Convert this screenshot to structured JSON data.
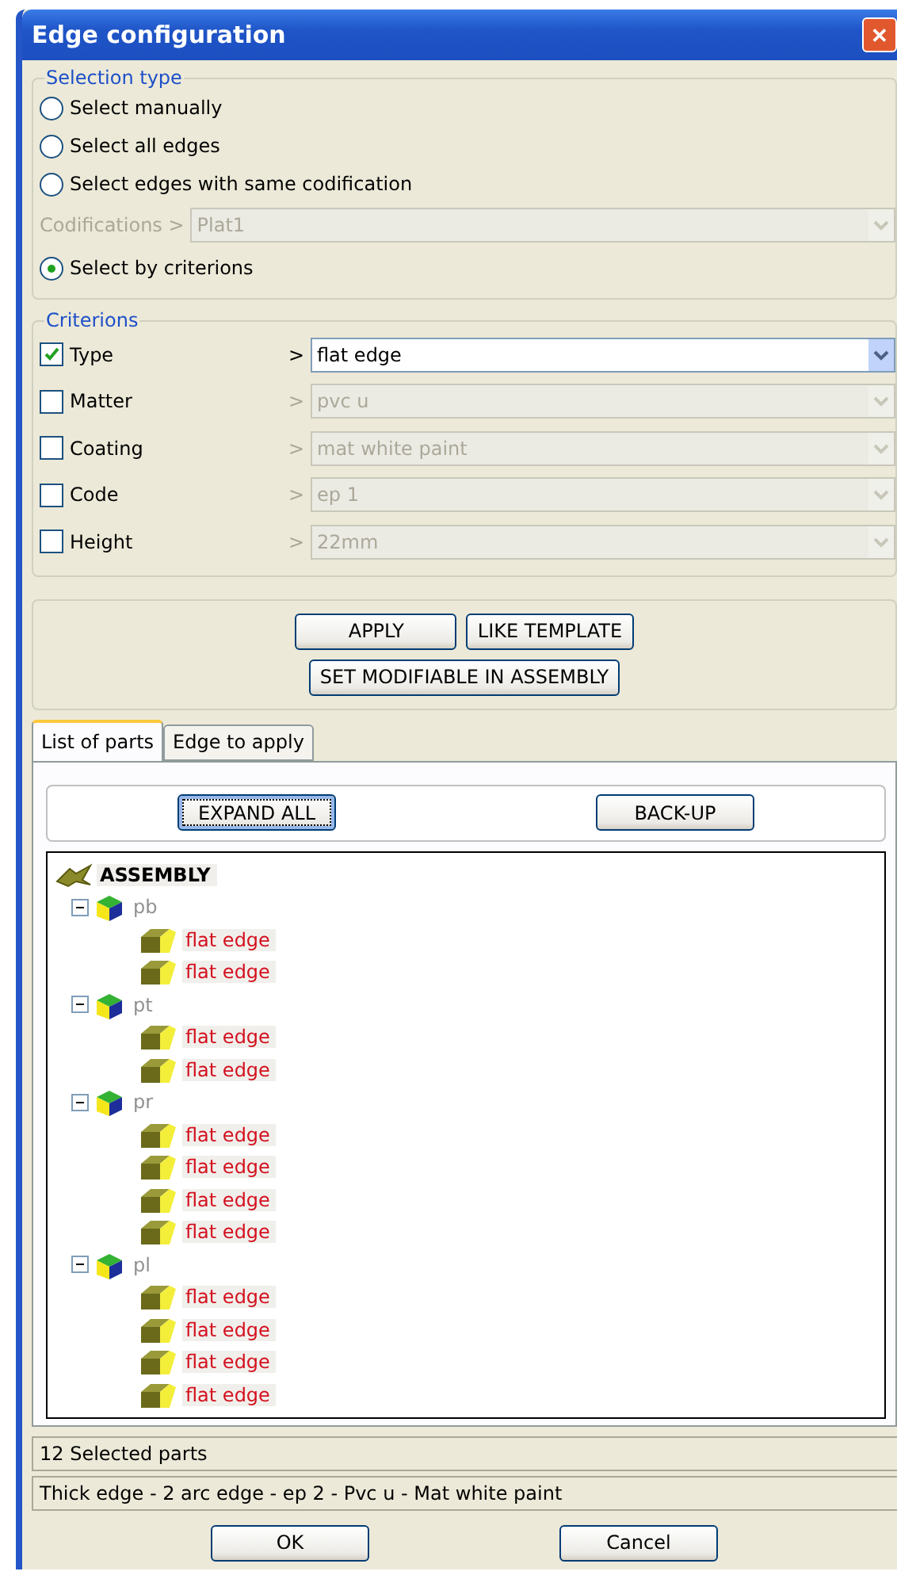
{
  "window": {
    "title": "Edge configuration",
    "close": "✕"
  },
  "selection_type": {
    "legend": "Selection type",
    "options": [
      {
        "label": "Select manually",
        "selected": false
      },
      {
        "label": "Select all edges",
        "selected": false
      },
      {
        "label": "Select edges with same codification",
        "selected": false
      },
      {
        "label": "Select by criterions",
        "selected": true
      }
    ],
    "codifications": {
      "label": "Codifications >",
      "value": "Plat1",
      "disabled": true
    }
  },
  "criterions": {
    "legend": "Criterions",
    "rows": [
      {
        "label": "Type",
        "checked": true,
        "separator": ">",
        "value": "flat edge"
      },
      {
        "label": "Matter",
        "checked": false,
        "separator": ">",
        "value": "pvc u"
      },
      {
        "label": "Coating",
        "checked": false,
        "separator": ">",
        "value": "mat white paint"
      },
      {
        "label": "Code",
        "checked": false,
        "separator": ">",
        "value": "ep 1"
      },
      {
        "label": "Height",
        "checked": false,
        "separator": ">",
        "value": "22mm"
      }
    ]
  },
  "actions": [
    "APPLY",
    "LIKE TEMPLATE",
    "SET MODIFIABLE IN ASSEMBLY"
  ],
  "tabs": [
    {
      "label": "List of parts",
      "selected": true
    },
    {
      "label": "Edge to apply",
      "selected": false
    }
  ],
  "tree_buttons": [
    {
      "label": "EXPAND ALL",
      "focused": true
    },
    {
      "label": "BACK-UP",
      "focused": false
    }
  ],
  "tree": [
    {
      "kind": "assembly",
      "label": "ASSEMBLY",
      "children": [
        {
          "kind": "part",
          "label": "pb",
          "expanded": true,
          "children": [
            {
              "kind": "edge",
              "label": "flat edge"
            },
            {
              "kind": "edge",
              "label": "flat edge"
            }
          ]
        },
        {
          "kind": "part",
          "label": "pt",
          "expanded": true,
          "children": [
            {
              "kind": "edge",
              "label": "flat edge"
            },
            {
              "kind": "edge",
              "label": "flat edge"
            }
          ]
        },
        {
          "kind": "part",
          "label": "pr",
          "expanded": true,
          "children": [
            {
              "kind": "edge",
              "label": "flat edge"
            },
            {
              "kind": "edge",
              "label": "flat edge"
            },
            {
              "kind": "edge",
              "label": "flat edge"
            },
            {
              "kind": "edge",
              "label": "flat edge"
            }
          ]
        },
        {
          "kind": "part",
          "label": "pl",
          "expanded": true,
          "children": [
            {
              "kind": "edge",
              "label": "flat edge"
            },
            {
              "kind": "edge",
              "label": "flat edge"
            },
            {
              "kind": "edge",
              "label": "flat edge"
            },
            {
              "kind": "edge",
              "label": "flat edge"
            }
          ]
        }
      ]
    }
  ],
  "status_bar": [
    "12 Selected parts",
    "Thick edge - 2 arc edge - ep 2 - Pvc u - Mat white paint"
  ],
  "buttons": [
    "OK",
    "Cancel"
  ]
}
